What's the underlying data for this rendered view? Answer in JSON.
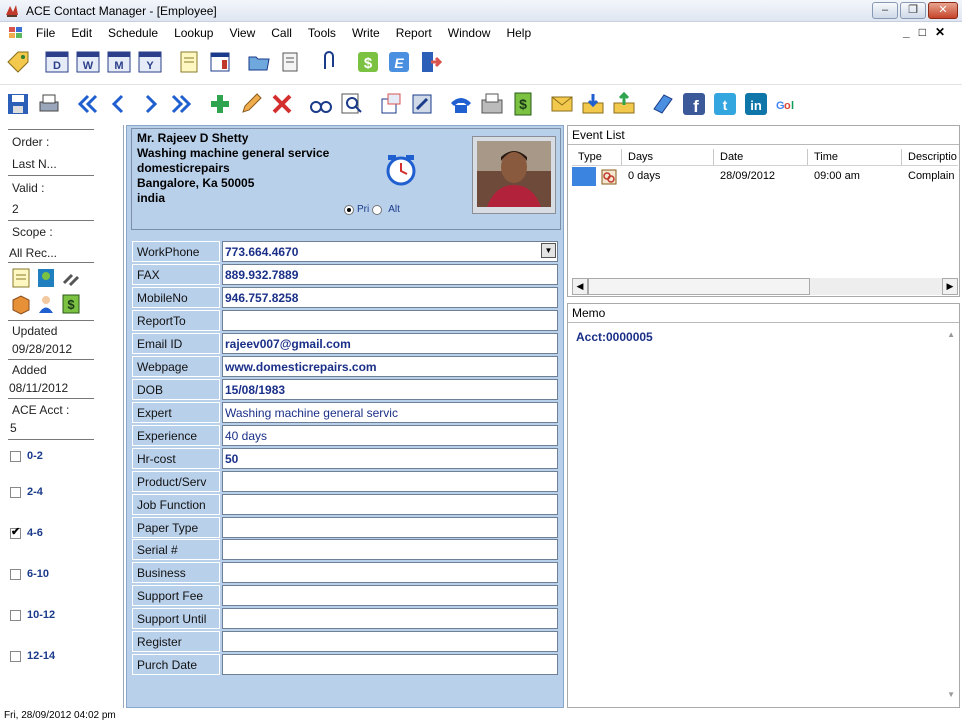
{
  "window": {
    "title": "ACE Contact Manager - [Employee]",
    "controls": [
      "minimize",
      "restore",
      "close"
    ]
  },
  "menu": {
    "items": [
      "File",
      "Edit",
      "Schedule",
      "Lookup",
      "View",
      "Call",
      "Tools",
      "Write",
      "Report",
      "Window",
      "Help"
    ],
    "mdi_controls": "_ Ā x"
  },
  "toolbar1": {
    "icons": [
      "tag-icon",
      "calendar-day-icon",
      "calendar-week-icon",
      "calendar-month-icon",
      "calendar-year-icon",
      "notepad-icon",
      "notes-icon",
      "folder-icon",
      "scroll-icon",
      "paperclip-icon",
      "dollar-icon",
      "e-icon",
      "exit-icon"
    ]
  },
  "toolbar2": {
    "icons": [
      "save-icon",
      "print-icon",
      "first-icon",
      "prev-icon",
      "next-icon",
      "last-icon",
      "add-icon",
      "edit-icon",
      "delete-icon",
      "binoculars-icon",
      "zoom-icon",
      "forms-icon",
      "labels-icon",
      "phone-icon",
      "fax-icon",
      "cash-icon",
      "letter-icon",
      "inbox-icon",
      "outbox-icon",
      "book-icon",
      "facebook-icon",
      "twitter-icon",
      "linkedin-icon",
      "google-icon"
    ]
  },
  "left": {
    "order_label": "Order :",
    "order_value": "Last N...",
    "valid_label": "Valid   :",
    "valid_value": "2",
    "scope_label": "Scope :",
    "scope_value": "All Rec...",
    "updated_label": "Updated",
    "updated_value": "09/28/2012",
    "added_label": "Added",
    "added_value": "08/11/2012",
    "acct_label": "ACE Acct :",
    "acct_value": "5",
    "ranges": [
      {
        "label": "0-2",
        "checked": false
      },
      {
        "label": "2-4",
        "checked": false
      },
      {
        "label": "4-6",
        "checked": true
      },
      {
        "label": "6-10",
        "checked": false
      },
      {
        "label": "10-12",
        "checked": false
      },
      {
        "label": "12-14",
        "checked": false
      }
    ]
  },
  "contact": {
    "name": "Mr. Rajeev D Shetty",
    "company": "Washing machine general service",
    "dept": "domesticrepairs",
    "city": "Bangalore, Ka 50005",
    "country": "india",
    "radio_pri": "Pri",
    "radio_alt": "Alt",
    "radio_selected": "Pri"
  },
  "fields": [
    {
      "label": "WorkPhone",
      "value": "773.664.4670"
    },
    {
      "label": "FAX",
      "value": "889.932.7889"
    },
    {
      "label": "MobileNo",
      "value": "946.757.8258"
    },
    {
      "label": "ReportTo",
      "value": ""
    },
    {
      "label": "Email ID",
      "value": "rajeev007@gmail.com"
    },
    {
      "label": "Webpage",
      "value": "www.domesticrepairs.com"
    },
    {
      "label": "DOB",
      "value": "15/08/1983"
    },
    {
      "label": "Expert",
      "value": "Washing machine general servic"
    },
    {
      "label": "Experience",
      "value": "40 days"
    },
    {
      "label": "Hr-cost",
      "value": "50"
    },
    {
      "label": "Product/Serv",
      "value": ""
    },
    {
      "label": "Job Function",
      "value": ""
    },
    {
      "label": "Paper Type",
      "value": ""
    },
    {
      "label": "Serial #",
      "value": ""
    },
    {
      "label": "Business",
      "value": ""
    },
    {
      "label": "Support Fee",
      "value": ""
    },
    {
      "label": "Support Until",
      "value": ""
    },
    {
      "label": "Register",
      "value": ""
    },
    {
      "label": "Purch Date",
      "value": ""
    }
  ],
  "events": {
    "title": "Event List",
    "columns": [
      "Type",
      "Days",
      "Date",
      "Time",
      "Descriptio"
    ],
    "rows": [
      {
        "days": "0 days",
        "date": "28/09/2012",
        "time": "09:00 am",
        "description": "Complain d"
      }
    ]
  },
  "memo": {
    "title": "Memo",
    "text": "Acct:0000005"
  },
  "status": {
    "text": "Fri, 28/09/2012  04:02 pm"
  }
}
